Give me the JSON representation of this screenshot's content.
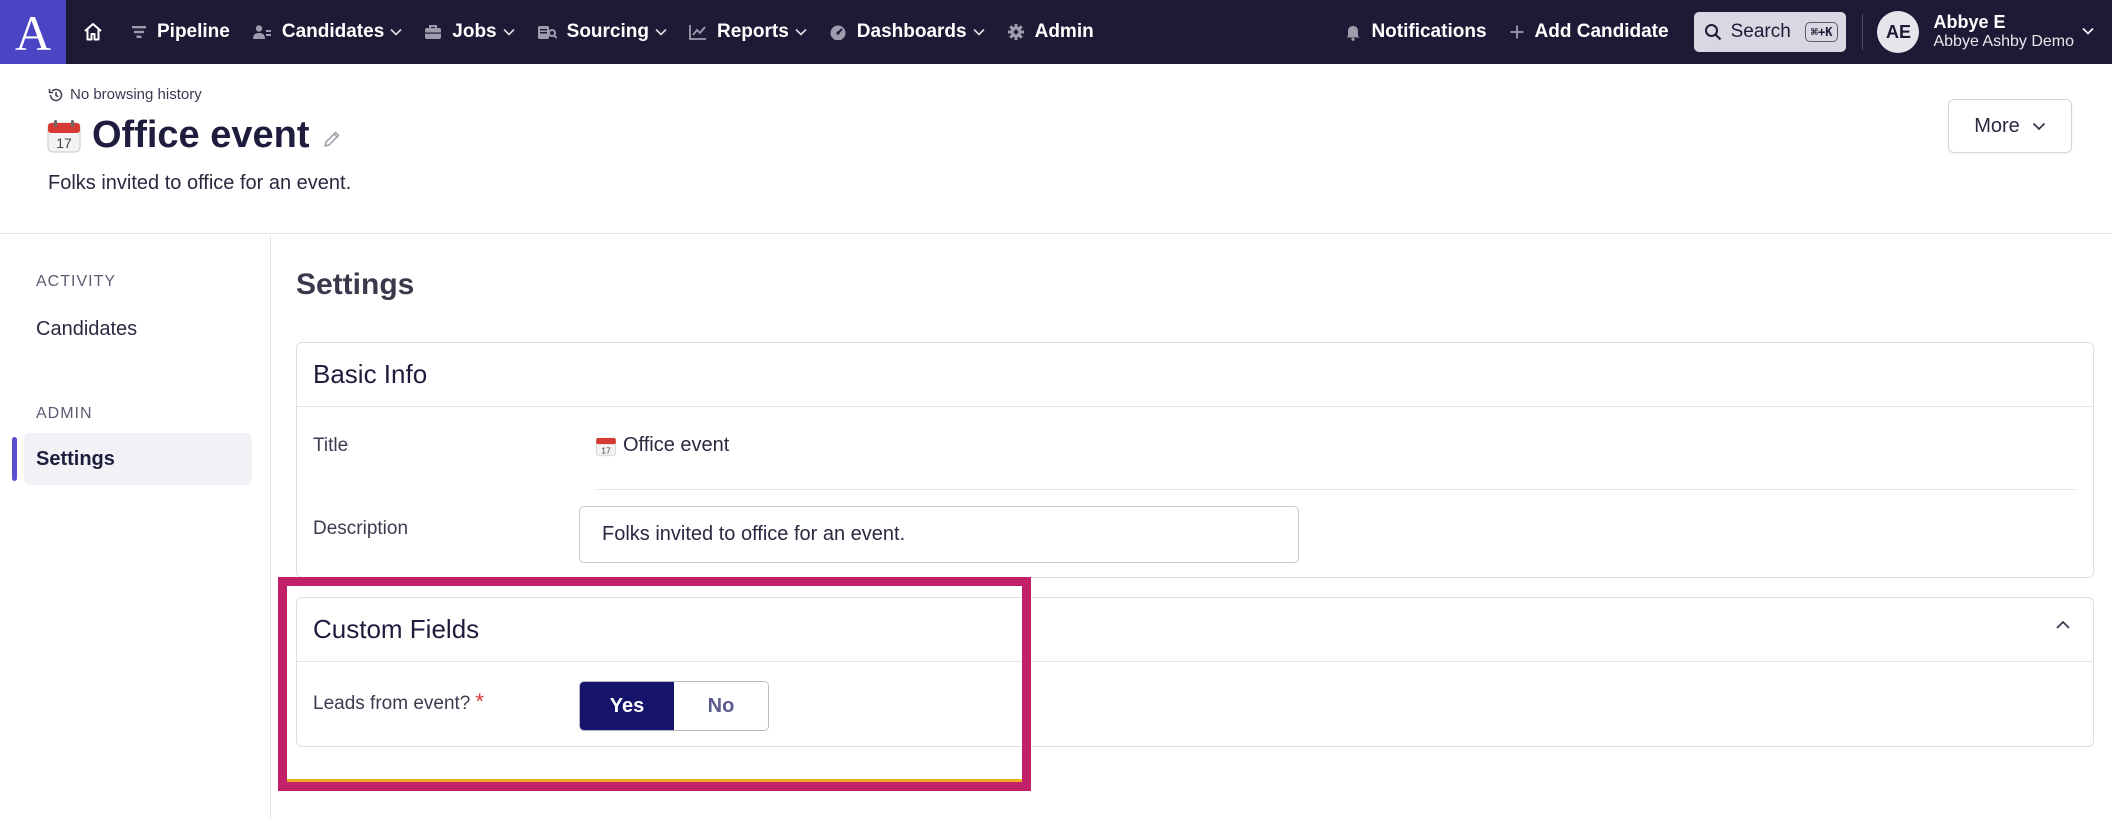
{
  "nav": {
    "logo_letter": "A",
    "items": [
      {
        "label": "Pipeline",
        "icon": "filter-icon"
      },
      {
        "label": "Candidates",
        "icon": "people-icon"
      },
      {
        "label": "Jobs",
        "icon": "briefcase-icon"
      },
      {
        "label": "Sourcing",
        "icon": "sourcing-icon"
      },
      {
        "label": "Reports",
        "icon": "chart-icon"
      },
      {
        "label": "Dashboards",
        "icon": "gauge-icon"
      },
      {
        "label": "Admin",
        "icon": "gear-icon"
      }
    ],
    "notifications": "Notifications",
    "add_candidate": "Add Candidate",
    "search": "Search",
    "search_shortcut": "⌘+K",
    "user": {
      "initials": "AE",
      "name": "Abbye E",
      "org": "Abbye Ashby Demo"
    }
  },
  "header": {
    "history": "No browsing history",
    "title": "Office event",
    "description": "Folks invited to office for an event.",
    "more": "More"
  },
  "sidebar": {
    "sections": [
      {
        "heading": "ACTIVITY",
        "items": [
          {
            "label": "Candidates",
            "active": false
          }
        ]
      },
      {
        "heading": "ADMIN",
        "items": [
          {
            "label": "Settings",
            "active": true
          }
        ]
      }
    ]
  },
  "main": {
    "title": "Settings",
    "basic_info": {
      "heading": "Basic Info",
      "title_label": "Title",
      "title_value": "Office event",
      "description_label": "Description",
      "description_value": "Folks invited to office for an event."
    },
    "custom_fields": {
      "heading": "Custom Fields",
      "field_label": "Leads from event?",
      "required_mark": "*",
      "options": [
        "Yes",
        "No"
      ],
      "selected": "Yes"
    }
  },
  "colors": {
    "nav_bg": "#1c1a35",
    "logo_bg": "#4b45c4",
    "toggle_selected": "#15136a",
    "highlight": "#c3206a",
    "sidebar_indicator": "#5a4fcf"
  }
}
